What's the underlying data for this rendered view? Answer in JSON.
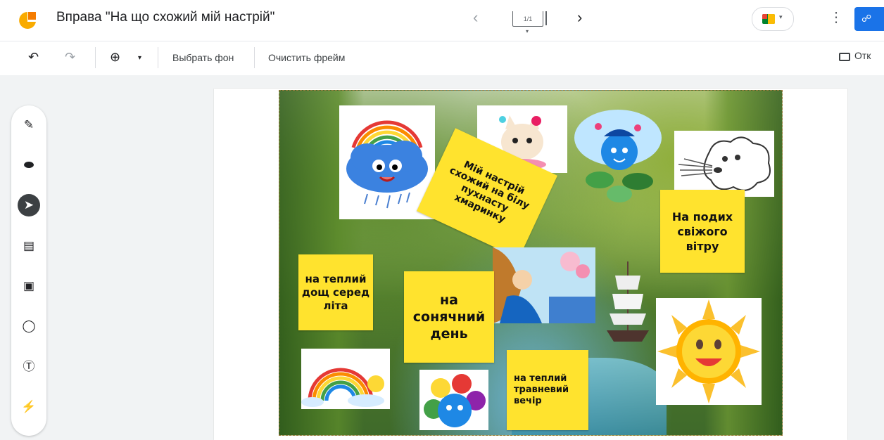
{
  "app": {
    "title": "Вправа \"На що схожий мій настрій\"",
    "frame_counter": "1/1"
  },
  "toolbar": {
    "choose_bg_label": "Выбрать фон",
    "clear_frame_label": "Очистить фрейм",
    "open_label": "Отк"
  },
  "stickies": {
    "cloud_mood": "Мій настрій схожий на білу пухнасту хмаринку",
    "fresh_wind": "На подих свіжого вітру",
    "summer_rain": "на теплий дощ серед літа",
    "sunny_day": "на сонячний день",
    "may_evening": "на теплий травневий вечір"
  },
  "colors": {
    "sticky_yellow": "#ffe32e",
    "accent_blue": "#1a73e8",
    "active_tool": "#3c4043"
  },
  "icons": [
    "back-arrow-icon",
    "forward-arrow-icon",
    "zoom-in-icon",
    "pen-icon",
    "eraser-icon",
    "select-icon",
    "sticky-note-icon",
    "image-icon",
    "circle-icon",
    "text-box-icon",
    "laser-icon",
    "more-vert-icon"
  ]
}
